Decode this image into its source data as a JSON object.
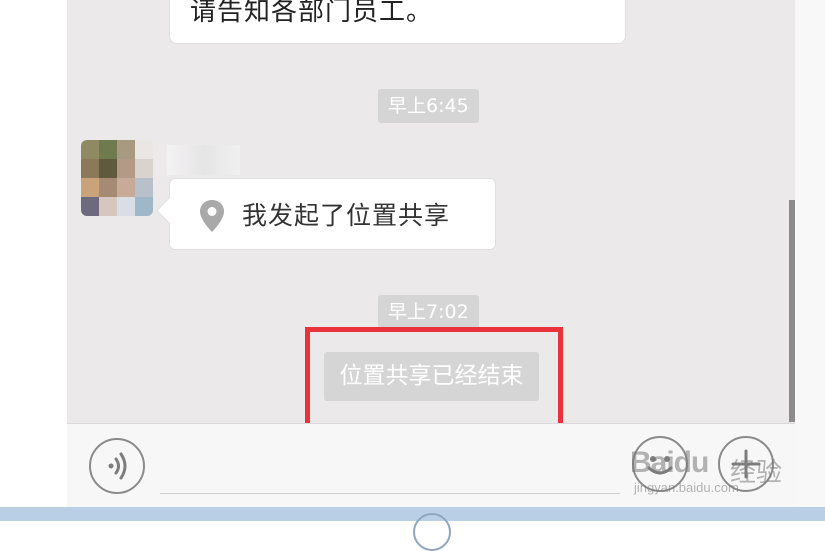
{
  "chat": {
    "previous_message_tail": "请告知各部门员工。",
    "timestamps": [
      "早上6:45",
      "早上7:02"
    ],
    "location_message": "我发起了位置共享",
    "system_message": "位置共享已经结束"
  },
  "icons": {
    "location": "location-pin-icon",
    "voice": "voice-icon",
    "emoji": "emoji-icon",
    "plus": "plus-icon"
  },
  "watermark": {
    "logo": "Baidu",
    "text": "经验",
    "url": "jingyan.baidu.com"
  },
  "colors": {
    "chat_background": "#ebe9ea",
    "timestamp_background": "#d6d5d6",
    "highlight": "#e8333b",
    "bottom_strip": "#b8cfe6"
  }
}
